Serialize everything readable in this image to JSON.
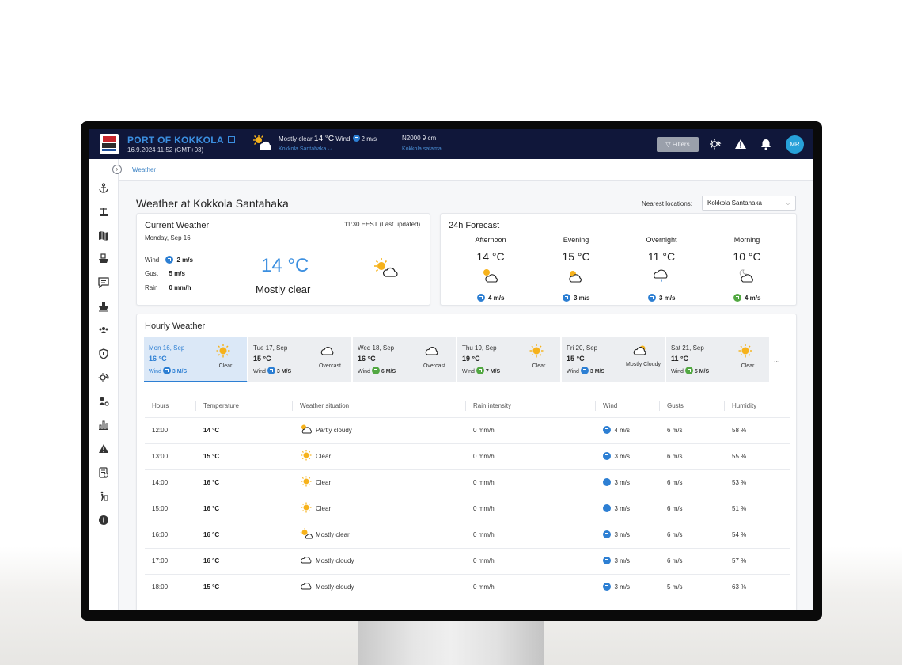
{
  "app": {
    "port_name": "PORT OF KOKKOLA",
    "datetime": "16.9.2024 11:52 (GMT+03)"
  },
  "topbar": {
    "weather_cond": "Mostly clear",
    "weather_temp": "14 °C",
    "wind_label": "Wind",
    "wind_value": "2 m/s",
    "weather_location": "Kokkola Santahaka",
    "sea_level": "N2000 9 cm",
    "sea_location": "Kokkola satama",
    "filters_label": "Filters",
    "avatar_initials": "MR"
  },
  "breadcrumb": "Weather",
  "page": {
    "title": "Weather at Kokkola Santahaka",
    "nearest_label": "Nearest locations:",
    "nearest_value": "Kokkola Santahaka"
  },
  "current": {
    "title": "Current Weather",
    "date": "Monday, Sep 16",
    "updated": "11:30 EEST (Last updated)",
    "wind_label": "Wind",
    "wind": "2 m/s",
    "gust_label": "Gust",
    "gust": "5 m/s",
    "rain_label": "Rain",
    "rain": "0 mm/h",
    "temp": "14 °C",
    "condition": "Mostly clear"
  },
  "forecast": {
    "title": "24h Forecast",
    "periods": [
      {
        "name": "Afternoon",
        "temp": "14 °C",
        "icon": "partly-cloudy-icon",
        "wind": "4 m/s"
      },
      {
        "name": "Evening",
        "temp": "15 °C",
        "icon": "partly-cloudy-icon",
        "wind": "3 m/s"
      },
      {
        "name": "Overnight",
        "temp": "11 °C",
        "icon": "rain-cloud-icon",
        "wind": "3 m/s"
      },
      {
        "name": "Morning",
        "temp": "10 °C",
        "icon": "night-cloudy-icon",
        "wind": "4 m/s"
      }
    ]
  },
  "hourly": {
    "title": "Hourly Weather",
    "wind_label": "Wind",
    "more": "...",
    "days": [
      {
        "name": "Mon 16, Sep",
        "temp": "16 °C",
        "wind": "3 M/S",
        "cond": "Clear",
        "icon": "sun-icon"
      },
      {
        "name": "Tue 17, Sep",
        "temp": "15 °C",
        "wind": "3 M/S",
        "cond": "Overcast",
        "icon": "cloud-icon"
      },
      {
        "name": "Wed 18, Sep",
        "temp": "16 °C",
        "wind": "6 M/S",
        "cond": "Overcast",
        "icon": "cloud-icon"
      },
      {
        "name": "Thu 19, Sep",
        "temp": "19 °C",
        "wind": "7 M/S",
        "cond": "Clear",
        "icon": "sun-icon"
      },
      {
        "name": "Fri 20, Sep",
        "temp": "15 °C",
        "wind": "3 M/S",
        "cond": "Mostly Cloudy",
        "icon": "partly-cloudy-icon"
      },
      {
        "name": "Sat 21, Sep",
        "temp": "11 °C",
        "wind": "5 M/S",
        "cond": "Clear",
        "icon": "sun-icon"
      }
    ],
    "columns": [
      "Hours",
      "Temperature",
      "Weather situation",
      "Rain intensity",
      "Wind",
      "Gusts",
      "Humidity"
    ],
    "rows": [
      {
        "hour": "12:00",
        "temp": "14 °C",
        "situation": "Partly cloudy",
        "icon": "partly-cloudy-icon",
        "rain": "0 mm/h",
        "wind": "4 m/s",
        "gusts": "6 m/s",
        "humidity": "58 %"
      },
      {
        "hour": "13:00",
        "temp": "15 °C",
        "situation": "Clear",
        "icon": "sun-icon",
        "rain": "0 mm/h",
        "wind": "3 m/s",
        "gusts": "6 m/s",
        "humidity": "55 %"
      },
      {
        "hour": "14:00",
        "temp": "16 °C",
        "situation": "Clear",
        "icon": "sun-icon",
        "rain": "0 mm/h",
        "wind": "3 m/s",
        "gusts": "6 m/s",
        "humidity": "53 %"
      },
      {
        "hour": "15:00",
        "temp": "16 °C",
        "situation": "Clear",
        "icon": "sun-icon",
        "rain": "0 mm/h",
        "wind": "3 m/s",
        "gusts": "6 m/s",
        "humidity": "51 %"
      },
      {
        "hour": "16:00",
        "temp": "16 °C",
        "situation": "Mostly clear",
        "icon": "mostly-clear-icon",
        "rain": "0 mm/h",
        "wind": "3 m/s",
        "gusts": "6 m/s",
        "humidity": "54 %"
      },
      {
        "hour": "17:00",
        "temp": "16 °C",
        "situation": "Mostly cloudy",
        "icon": "cloud-icon",
        "rain": "0 mm/h",
        "wind": "3 m/s",
        "gusts": "6 m/s",
        "humidity": "57 %"
      },
      {
        "hour": "18:00",
        "temp": "15 °C",
        "situation": "Mostly cloudy",
        "icon": "cloud-icon",
        "rain": "0 mm/h",
        "wind": "3 m/s",
        "gusts": "5 m/s",
        "humidity": "63 %"
      }
    ]
  },
  "colors": {
    "topbar": "#10173a",
    "accent": "#2d7fd3",
    "wind_green": "#52a842",
    "sun": "#f6b21b"
  }
}
